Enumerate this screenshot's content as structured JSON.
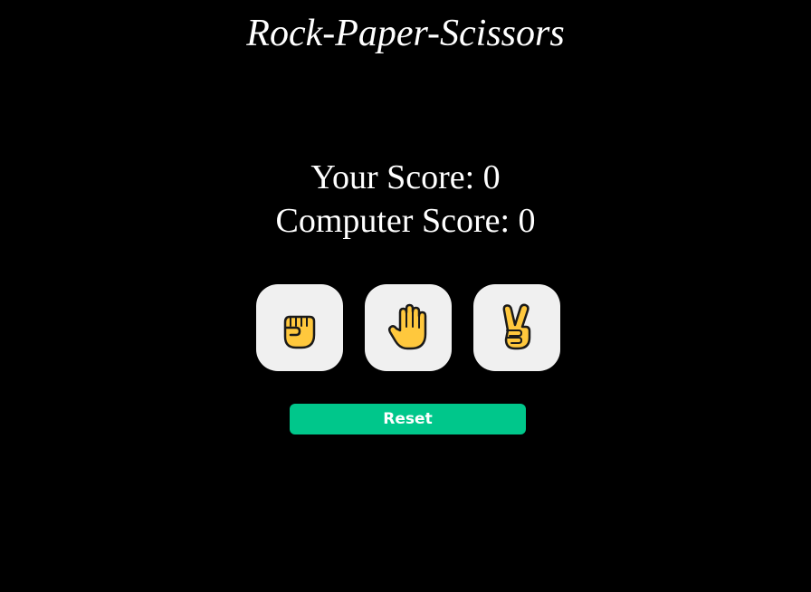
{
  "title": "Rock-Paper-Scissors",
  "scores": {
    "player_label": "Your Score: 0",
    "computer_label": "Computer Score: 0",
    "player": 0,
    "computer": 0
  },
  "choices": [
    {
      "name": "rock",
      "icon": "raised-fist-icon"
    },
    {
      "name": "paper",
      "icon": "raised-hand-icon"
    },
    {
      "name": "scissors",
      "icon": "victory-hand-icon"
    }
  ],
  "reset_label": "Reset",
  "colors": {
    "background": "#000000",
    "text": "#ffffff",
    "choice_bg": "#f0f0f0",
    "reset_bg": "#00c78b",
    "emoji_fill": "#ffc83d",
    "emoji_outline": "#1a1a1a"
  }
}
